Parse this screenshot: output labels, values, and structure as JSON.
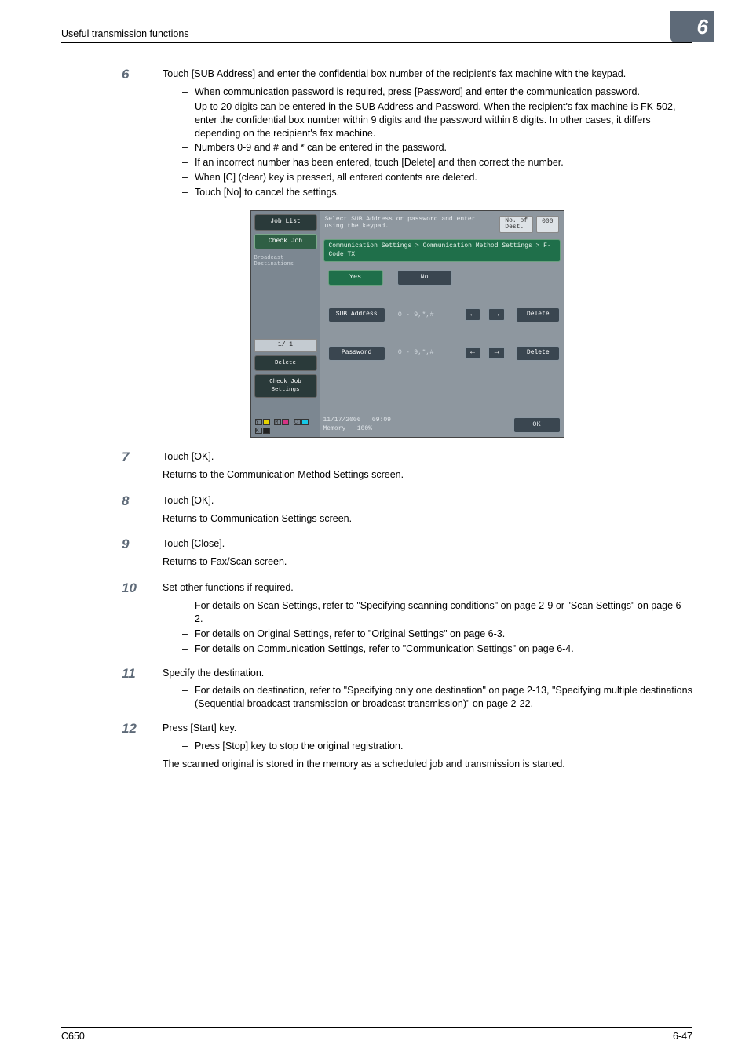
{
  "header": {
    "section_title": "Useful transmission functions",
    "chapter_num": "6"
  },
  "footer": {
    "left": "C650",
    "right": "6-47"
  },
  "steps": {
    "s6": {
      "num": "6",
      "text": "Touch [SUB Address] and enter the confidential box number of the recipient's fax machine with the keypad.",
      "bullets": [
        "When communication password is required, press [Password] and enter the communication password.",
        "Up to 20 digits can be entered in the SUB Address and Password. When the recipient's fax machine is FK-502, enter the confidential box number within 9 digits and the password within 8 digits. In other cases, it differs depending on the recipient's fax machine.",
        "Numbers 0-9 and # and * can be entered in the password.",
        "If an incorrect number has been entered, touch [Delete] and then correct the number.",
        "When [C] (clear) key is pressed, all entered contents are deleted.",
        "Touch [No] to cancel the settings."
      ]
    },
    "s7": {
      "num": "7",
      "text": "Touch [OK].",
      "after": "Returns to the Communication Method Settings screen."
    },
    "s8": {
      "num": "8",
      "text": "Touch [OK].",
      "after": "Returns to Communication Settings screen."
    },
    "s9": {
      "num": "9",
      "text": "Touch [Close].",
      "after": "Returns to Fax/Scan screen."
    },
    "s10": {
      "num": "10",
      "text": "Set other functions if required.",
      "bullets": [
        "For details on Scan Settings, refer to \"Specifying scanning conditions\" on page 2-9 or \"Scan Settings\" on page 6-2.",
        "For details on Original Settings, refer to \"Original Settings\" on page 6-3.",
        "For details on Communication Settings, refer to \"Communication Settings\" on page 6-4."
      ]
    },
    "s11": {
      "num": "11",
      "text": "Specify the destination.",
      "bullets": [
        "For details on destination, refer to \"Specifying only one destination\" on page 2-13, \"Specifying multiple destinations (Sequential broadcast transmission or broadcast transmission)\" on page 2-22."
      ]
    },
    "s12": {
      "num": "12",
      "text": "Press [Start] key.",
      "bullets": [
        "Press [Stop] key to stop the original registration."
      ],
      "after": "The scanned original is stored in the memory as a scheduled job and transmission is started."
    }
  },
  "screenshot": {
    "left_panel": {
      "job_list": "Job List",
      "check_job": "Check Job",
      "broadcast": "Broadcast\nDestinations",
      "pager": "1/ 1",
      "delete": "Delete",
      "check_job_settings": "Check Job\nSettings",
      "toner": {
        "y": "Y",
        "m": "M",
        "c": "C",
        "k": "K"
      }
    },
    "top": {
      "instruction": "Select SUB Address or password and enter\nusing the keypad.",
      "dest_label": "No. of\nDest.",
      "dest_count": "000"
    },
    "crumb": "Communication Settings > Communication Method Settings > F-Code TX",
    "yes": "Yes",
    "no": "No",
    "sub_address": "SUB Address",
    "password": "Password",
    "range": "0 - 9,*,#",
    "delete": "Delete",
    "bottom": {
      "date": "11/17/2006",
      "time": "09:09",
      "mem_label": "Memory",
      "mem_val": "100%",
      "ok": "OK"
    }
  }
}
